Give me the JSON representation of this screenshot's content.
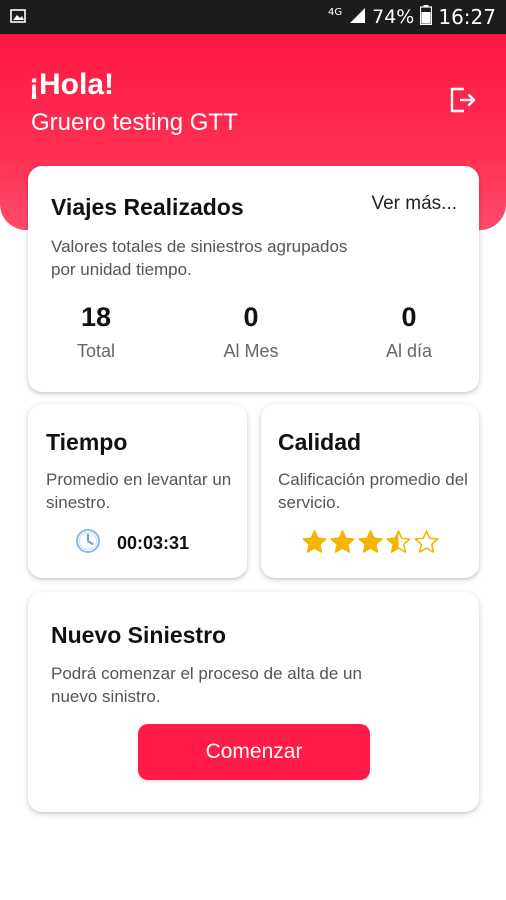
{
  "status_bar": {
    "network": "4G",
    "battery": "74%",
    "time": "16:27",
    "icons": [
      "image-notification-icon",
      "signal-icon",
      "battery-icon"
    ]
  },
  "header": {
    "greeting": "¡Hola!",
    "user": "Gruero testing GTT",
    "logout_icon": "logout-icon"
  },
  "viajes": {
    "title": "Viajes Realizados",
    "link": "Ver más...",
    "description": "Valores totales de siniestros agrupados\n por unidad tiempo.",
    "stats": [
      {
        "value": "18",
        "label": "Total"
      },
      {
        "value": "0",
        "label": "Al Mes"
      },
      {
        "value": "0",
        "label": "Al día"
      }
    ]
  },
  "tiempo": {
    "title": "Tiempo",
    "description": "Promedio en levantar un sinestro.",
    "value": "00:03:31",
    "icon": "clock-icon"
  },
  "calidad": {
    "title": "Calidad",
    "description": "Calificación promedio del servicio.",
    "rating": 3.5,
    "max_rating": 5,
    "star_color": "#f5b400"
  },
  "nuevo": {
    "title": "Nuevo Siniestro",
    "description": "Podrá comenzar el proceso de alta de un nuevo sinistro.",
    "button": "Comenzar"
  },
  "colors": {
    "accent": "#ff1a47",
    "status_bar": "#1c1c1e"
  }
}
